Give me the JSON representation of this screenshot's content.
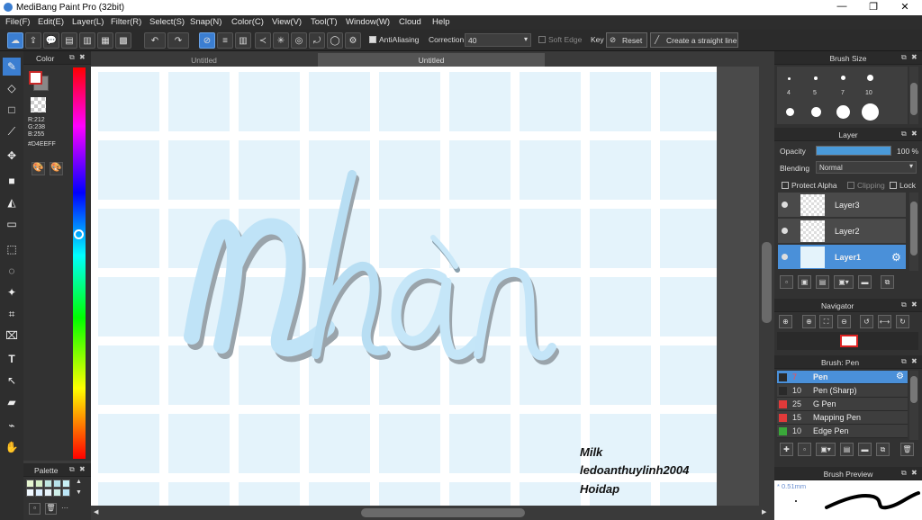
{
  "app": {
    "title": "MediBang Paint Pro (32bit)"
  },
  "menu": [
    "File(F)",
    "Edit(E)",
    "Layer(L)",
    "Filter(R)",
    "Select(S)",
    "Snap(N)",
    "Color(C)",
    "View(V)",
    "Tool(T)",
    "Window(W)",
    "Cloud",
    "Help"
  ],
  "toolbar": {
    "antialiasing": "AntiAliasing",
    "correction_label": "Correction",
    "correction_value": "40",
    "soft_edge": "Soft Edge",
    "key": "Key",
    "reset": "Reset",
    "straight_line": "Create a straight line"
  },
  "color_panel": {
    "title": "Color",
    "r": "R:212",
    "g": "G:238",
    "b": "B:255",
    "hex": "#D4EEFF",
    "main_color": "#d4eeff"
  },
  "palette": {
    "title": "Palette",
    "swatches": [
      "#e6f5d0",
      "#d6efc6",
      "#bfe6e0",
      "#b7e3ea",
      "#c8f0f5",
      "#f0f8ff",
      "#dcefff",
      "#e8f4fa",
      "#d0f0ea",
      "#bde7f7"
    ]
  },
  "tabs": [
    "Untitled",
    "Untitled"
  ],
  "canvas": {
    "lettering": "Nhàn",
    "tile_color": "#e4f3fb",
    "watermark": [
      "Milk",
      "ledoanthuylinh2004",
      "Hoidap"
    ]
  },
  "brush_size": {
    "title": "Brush Size",
    "labels": [
      "4",
      "5",
      "7",
      "10"
    ]
  },
  "layer_panel": {
    "title": "Layer",
    "opacity_label": "Opacity",
    "opacity_value": "100 %",
    "opacity": 100,
    "blending_label": "Blending",
    "blending_value": "Normal",
    "protect_alpha": "Protect Alpha",
    "clipping": "Clipping",
    "lock": "Lock",
    "layers": [
      "Layer3",
      "Layer2",
      "Layer1"
    ]
  },
  "navigator": {
    "title": "Navigator"
  },
  "brush_panel": {
    "title": "Brush: Pen",
    "brushes": [
      {
        "size": "7",
        "name": "Pen",
        "color": "#2a2a2a"
      },
      {
        "size": "10",
        "name": "Pen (Sharp)",
        "color": "#2a2a2a"
      },
      {
        "size": "25",
        "name": "G Pen",
        "color": "#e03a3a"
      },
      {
        "size": "15",
        "name": "Mapping Pen",
        "color": "#e03a3a"
      },
      {
        "size": "10",
        "name": "Edge Pen",
        "color": "#3aa83a"
      }
    ]
  },
  "brush_preview": {
    "title": "Brush Preview",
    "size": "0.51mm"
  }
}
